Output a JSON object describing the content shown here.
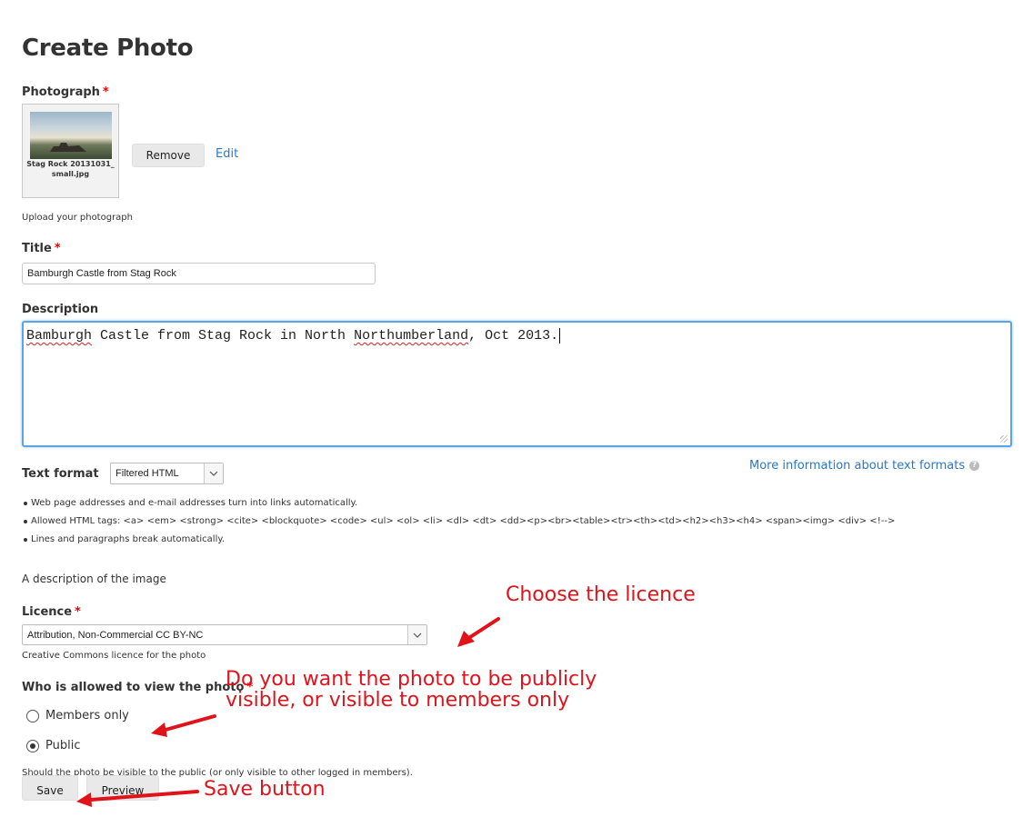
{
  "page": {
    "title": "Create Photo"
  },
  "photograph": {
    "label": "Photograph",
    "required_mark": "*",
    "file_name": "Stag Rock 20131031_small.jpg",
    "remove_label": "Remove",
    "edit_label": "Edit",
    "help": "Upload your photograph"
  },
  "title_field": {
    "label": "Title",
    "required_mark": "*",
    "value": "Bamburgh Castle from Stag Rock"
  },
  "description": {
    "label": "Description",
    "text_before": "Bamburgh",
    "text_middle": " Castle from Stag Rock in North ",
    "text_misspelled": "Northumberland",
    "text_after": ", Oct 2013.",
    "help": "A description of the image"
  },
  "text_format": {
    "label": "Text format",
    "selected": "Filtered HTML",
    "more_info_link": "More information about text formats",
    "tips": [
      "Web page addresses and e-mail addresses turn into links automatically.",
      "Allowed HTML tags: <a> <em> <strong> <cite> <blockquote> <code> <ul> <ol> <li> <dl> <dt> <dd><p><br><table><tr><th><td><h2><h3><h4> <span><img> <div> <!-->",
      "Lines and paragraphs break automatically."
    ]
  },
  "licence": {
    "label": "Licence",
    "required_mark": "*",
    "selected": "Attribution, Non-Commercial CC BY-NC",
    "help": "Creative Commons licence for the photo"
  },
  "visibility": {
    "label": "Who is allowed to view the photo",
    "required_mark": "*",
    "options": [
      {
        "label": "Members only",
        "selected": false
      },
      {
        "label": "Public",
        "selected": true
      }
    ],
    "help": "Should the photo be visible to the public (or only visible to other logged in members)."
  },
  "actions": {
    "save_label": "Save",
    "preview_label": "Preview"
  },
  "annotations": {
    "licence": "Choose the licence",
    "visibility_line1": "Do you want the photo to be publicly",
    "visibility_line2": "visible, or visible to members only",
    "save": "Save button",
    "color": "#e0131b"
  }
}
